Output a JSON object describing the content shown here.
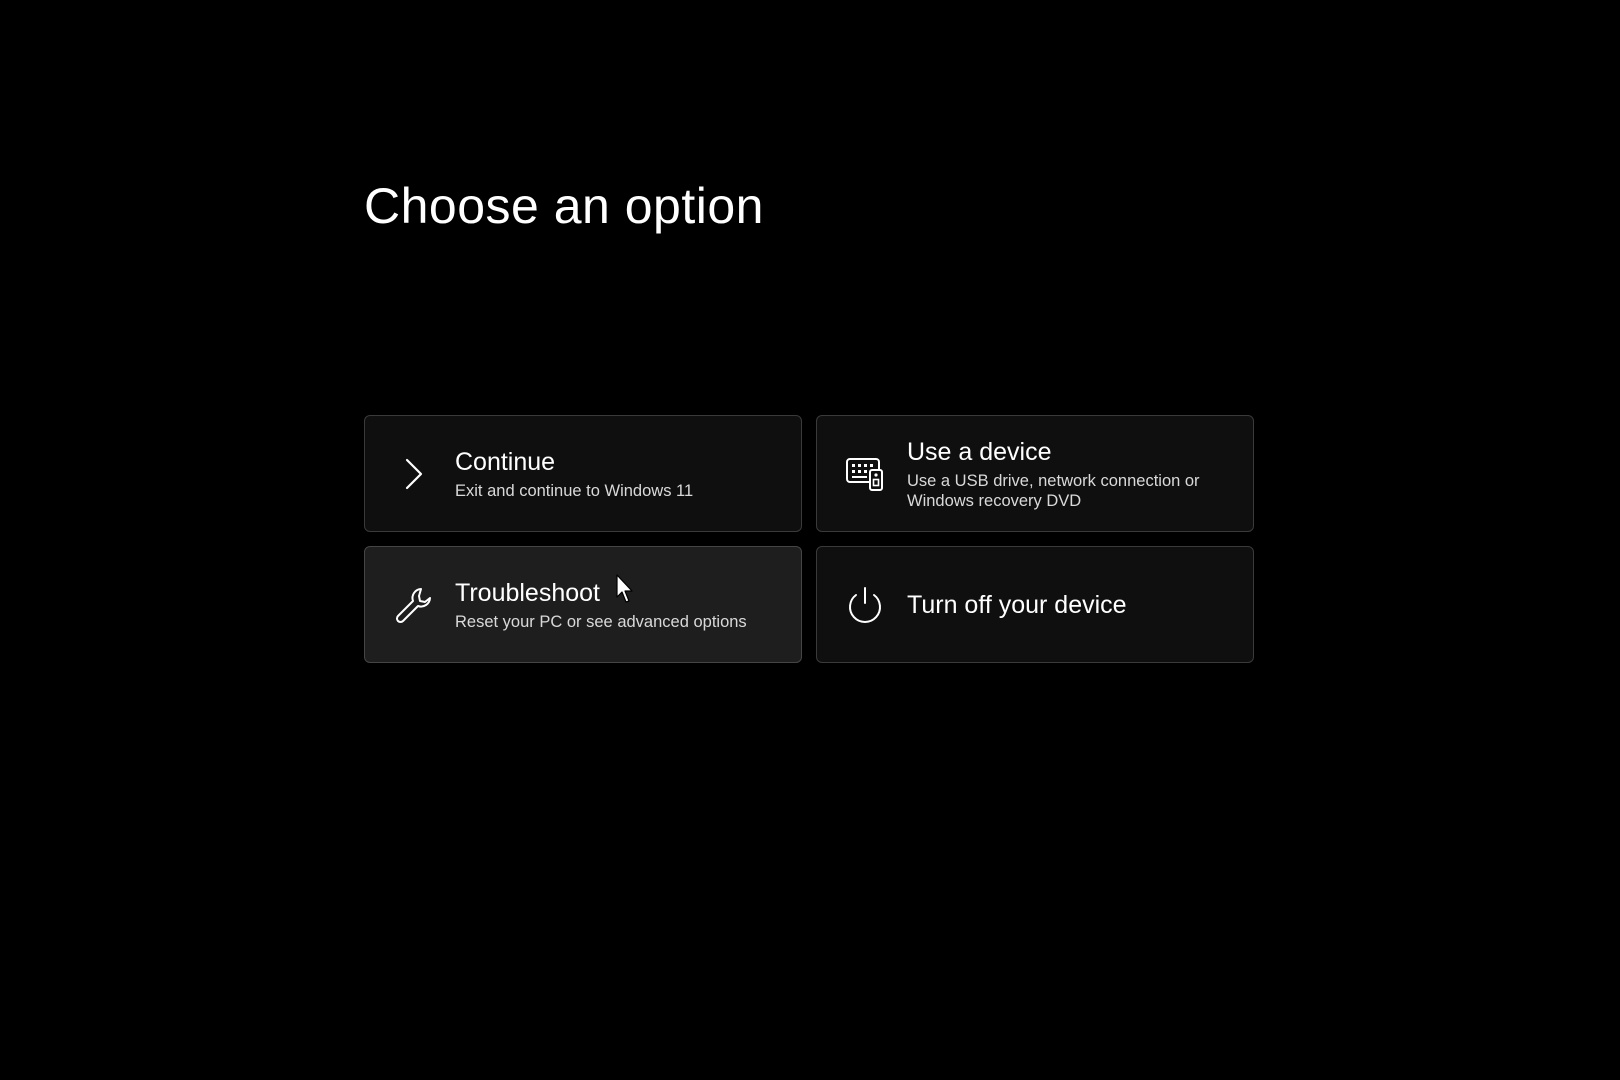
{
  "page": {
    "title": "Choose an option"
  },
  "options": [
    {
      "title": "Continue",
      "description": "Exit and continue to Windows 11",
      "icon": "chevron-right-icon"
    },
    {
      "title": "Use a device",
      "description": "Use a USB drive, network connection or Windows recovery DVD",
      "icon": "device-icon"
    },
    {
      "title": "Troubleshoot",
      "description": "Reset your PC or see advanced options",
      "icon": "wrench-icon"
    },
    {
      "title": "Turn off your device",
      "icon": "power-icon"
    }
  ],
  "colors": {
    "background": "#000000",
    "tile": "#0f0f0f",
    "tile_hover": "#1e1e1e",
    "tile_border": "#3a3a3a",
    "text": "#ffffff",
    "subtext": "#d9d9d9"
  },
  "pointer": {
    "icon": "mouse-pointer-icon"
  }
}
